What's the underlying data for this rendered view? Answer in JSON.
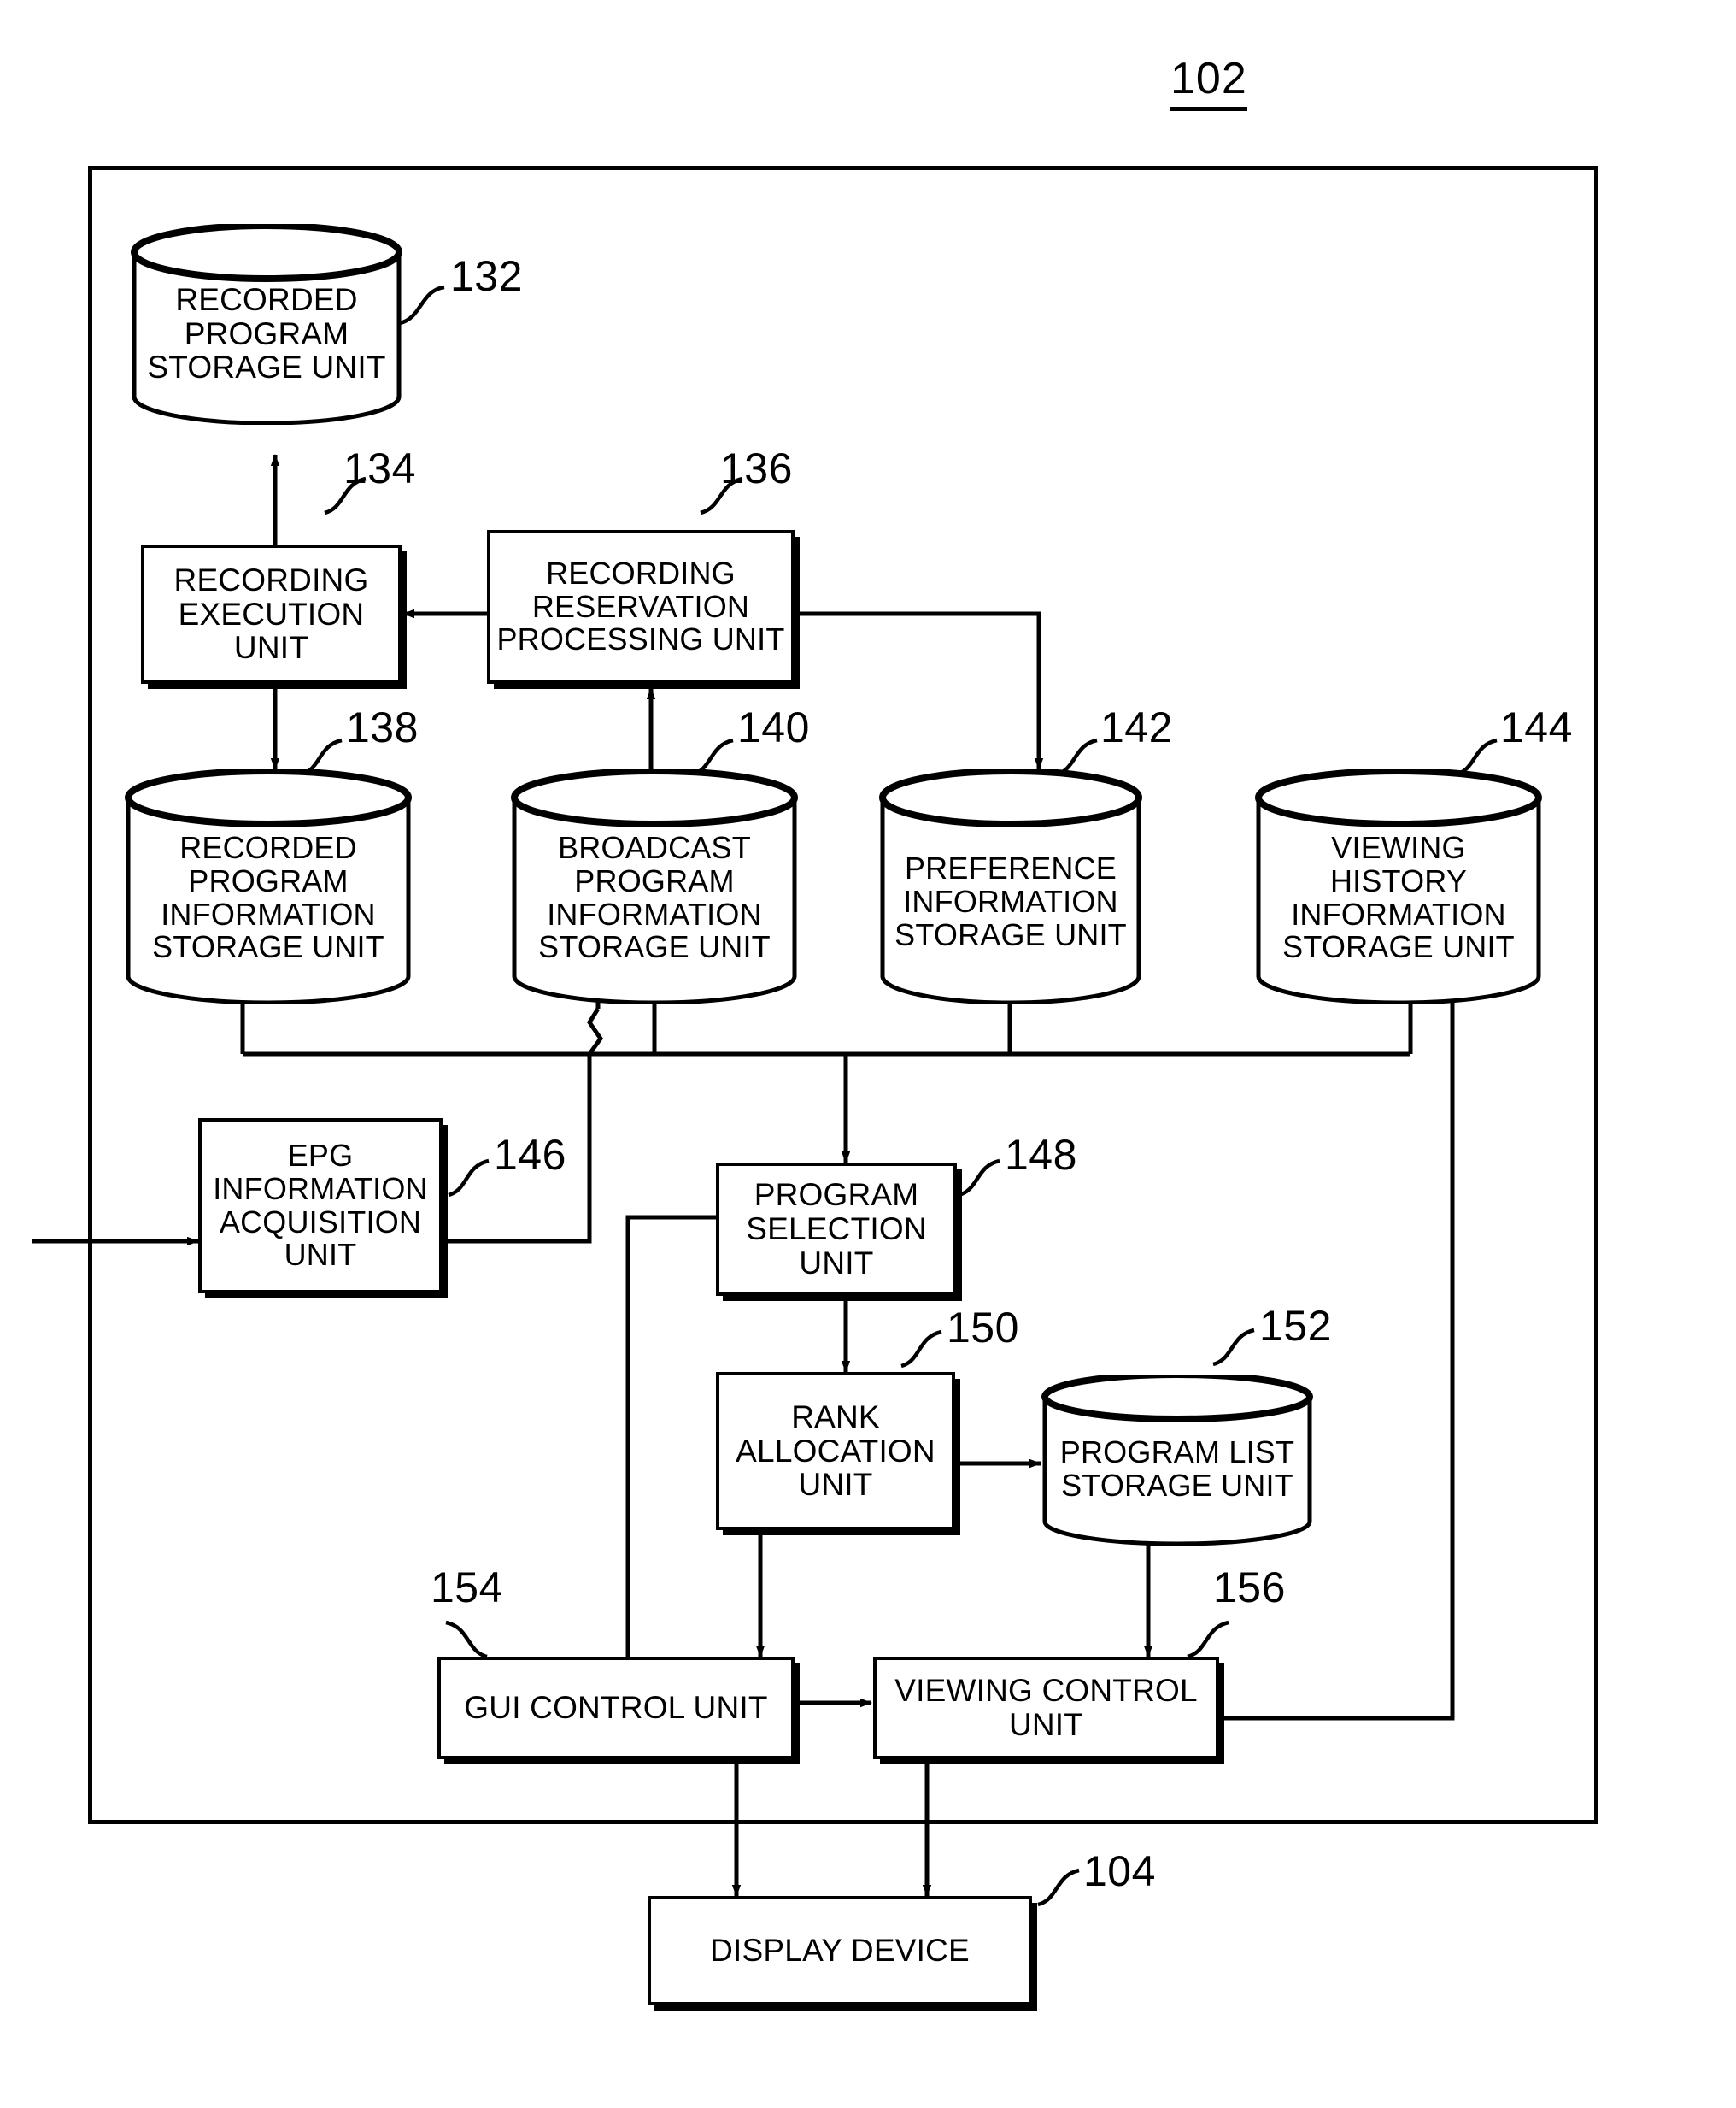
{
  "figure": {
    "reference_label": "102",
    "system_frame_name": "video-recording-system-frame"
  },
  "nodes": [
    {
      "id": "recorded_program_storage",
      "ref": "132",
      "shape": "cylinder",
      "label": "RECORDED\nPROGRAM\nSTORAGE UNIT"
    },
    {
      "id": "recording_execution",
      "ref": "134",
      "shape": "rect",
      "label": "RECORDING\nEXECUTION\nUNIT"
    },
    {
      "id": "recording_reservation_processing",
      "ref": "136",
      "shape": "rect",
      "label": "RECORDING\nRESERVATION\nPROCESSING UNIT"
    },
    {
      "id": "recorded_program_information_storage",
      "ref": "138",
      "shape": "cylinder",
      "label": "RECORDED\nPROGRAM\nINFORMATION\nSTORAGE UNIT"
    },
    {
      "id": "broadcast_program_information_storage",
      "ref": "140",
      "shape": "cylinder",
      "label": "BROADCAST\nPROGRAM\nINFORMATION\nSTORAGE UNIT"
    },
    {
      "id": "preference_information_storage",
      "ref": "142",
      "shape": "cylinder",
      "label": "PREFERENCE\nINFORMATION\nSTORAGE UNIT"
    },
    {
      "id": "viewing_history_information_storage",
      "ref": "144",
      "shape": "cylinder",
      "label": "VIEWING\nHISTORY\nINFORMATION\nSTORAGE UNIT"
    },
    {
      "id": "epg_information_acquisition",
      "ref": "146",
      "shape": "rect",
      "label": "EPG\nINFORMATION\nACQUISITION\nUNIT"
    },
    {
      "id": "program_selection",
      "ref": "148",
      "shape": "rect",
      "label": "PROGRAM\nSELECTION\nUNIT"
    },
    {
      "id": "rank_allocation",
      "ref": "150",
      "shape": "rect",
      "label": "RANK\nALLOCATION\nUNIT"
    },
    {
      "id": "program_list_storage",
      "ref": "152",
      "shape": "cylinder",
      "label": "PROGRAM LIST\nSTORAGE UNIT"
    },
    {
      "id": "gui_control",
      "ref": "154",
      "shape": "rect",
      "label": "GUI CONTROL UNIT"
    },
    {
      "id": "viewing_control",
      "ref": "156",
      "shape": "rect",
      "label": "VIEWING CONTROL\nUNIT"
    },
    {
      "id": "display_device",
      "ref": "104",
      "shape": "rect",
      "label": "DISPLAY DEVICE"
    }
  ],
  "connections": [
    {
      "from": "recording_execution",
      "to": "recorded_program_storage",
      "arrow": "single"
    },
    {
      "from": "recording_reservation_processing",
      "to": "recording_execution",
      "arrow": "single"
    },
    {
      "from": "recording_execution",
      "to": "recorded_program_information_storage",
      "arrow": "single"
    },
    {
      "from": "broadcast_program_information_storage",
      "to": "recording_reservation_processing",
      "arrow": "single"
    },
    {
      "from": "recording_reservation_processing",
      "to": "preference_information_storage",
      "arrow": "single"
    },
    {
      "from": "external_input",
      "to": "epg_information_acquisition",
      "arrow": "single"
    },
    {
      "from": "epg_information_acquisition",
      "to": "broadcast_program_information_storage",
      "arrow": "single"
    },
    {
      "from": "storage_bus",
      "to": "program_selection",
      "arrow": "single"
    },
    {
      "from": "gui_control",
      "to": "program_selection",
      "arrow": "single"
    },
    {
      "from": "program_selection",
      "to": "rank_allocation",
      "arrow": "single"
    },
    {
      "from": "rank_allocation",
      "to": "program_list_storage",
      "arrow": "single"
    },
    {
      "from": "rank_allocation",
      "to": "gui_control",
      "arrow": "single"
    },
    {
      "from": "program_list_storage",
      "to": "viewing_control",
      "arrow": "single"
    },
    {
      "from": "gui_control",
      "to": "viewing_control",
      "arrow": "single"
    },
    {
      "from": "viewing_control",
      "to": "viewing_history_information_storage",
      "arrow": "single"
    },
    {
      "from": "gui_control",
      "to": "display_device",
      "arrow": "double"
    },
    {
      "from": "viewing_control",
      "to": "display_device",
      "arrow": "single"
    }
  ],
  "colors": {
    "line": "#000000",
    "background": "#ffffff"
  }
}
